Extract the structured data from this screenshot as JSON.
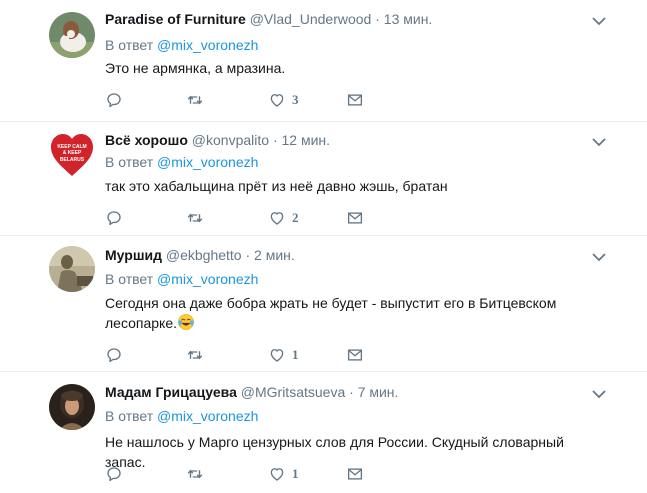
{
  "reply_prefix": "В ответ",
  "tweets": [
    {
      "name": "Paradise of Furniture",
      "handle": "@Vlad_Underwood",
      "time": "13 мин.",
      "reply_to": "@mix_voronezh",
      "text": "Это не армянка, а мразина.",
      "likes": "3",
      "avatar": "dog-photo"
    },
    {
      "name": "Всё хорошо",
      "handle": "@konvpalito",
      "time": "12 мин.",
      "reply_to": "@mix_voronezh",
      "text": "так это хабальщина прёт из неё давно жэшь, братан",
      "likes": "2",
      "avatar": "heart-logo",
      "avatar_text": [
        "KEEP CALM",
        "& KEEP",
        "BELARUS"
      ]
    },
    {
      "name": "Муршид",
      "handle": "@ekbghetto",
      "time": "2 мин.",
      "reply_to": "@mix_voronezh",
      "text_line1": "Сегодня она даже бобра жрать не будет - выпустит его в Битцевском",
      "text_line2": "лесопарке.",
      "emoji": "face-with-tears-of-joy",
      "likes": "1",
      "avatar": "sepia-photo"
    },
    {
      "name": "Мадам Грицацуева",
      "handle": "@MGritsatsueva",
      "time": "7 мин.",
      "reply_to": "@mix_voronezh",
      "text": "Не нашлось у Марго цензурных слов для России. Скудный словарный запас.",
      "likes": "1",
      "avatar": "woman-photo"
    }
  ],
  "separator": "·",
  "icons": [
    "reply-icon",
    "retweet-icon",
    "like-icon",
    "message-icon",
    "chevron-down-icon"
  ],
  "colors": {
    "name": "#14171a",
    "secondary": "#657786",
    "link": "#1b95e0",
    "border": "#e6ecf0"
  }
}
